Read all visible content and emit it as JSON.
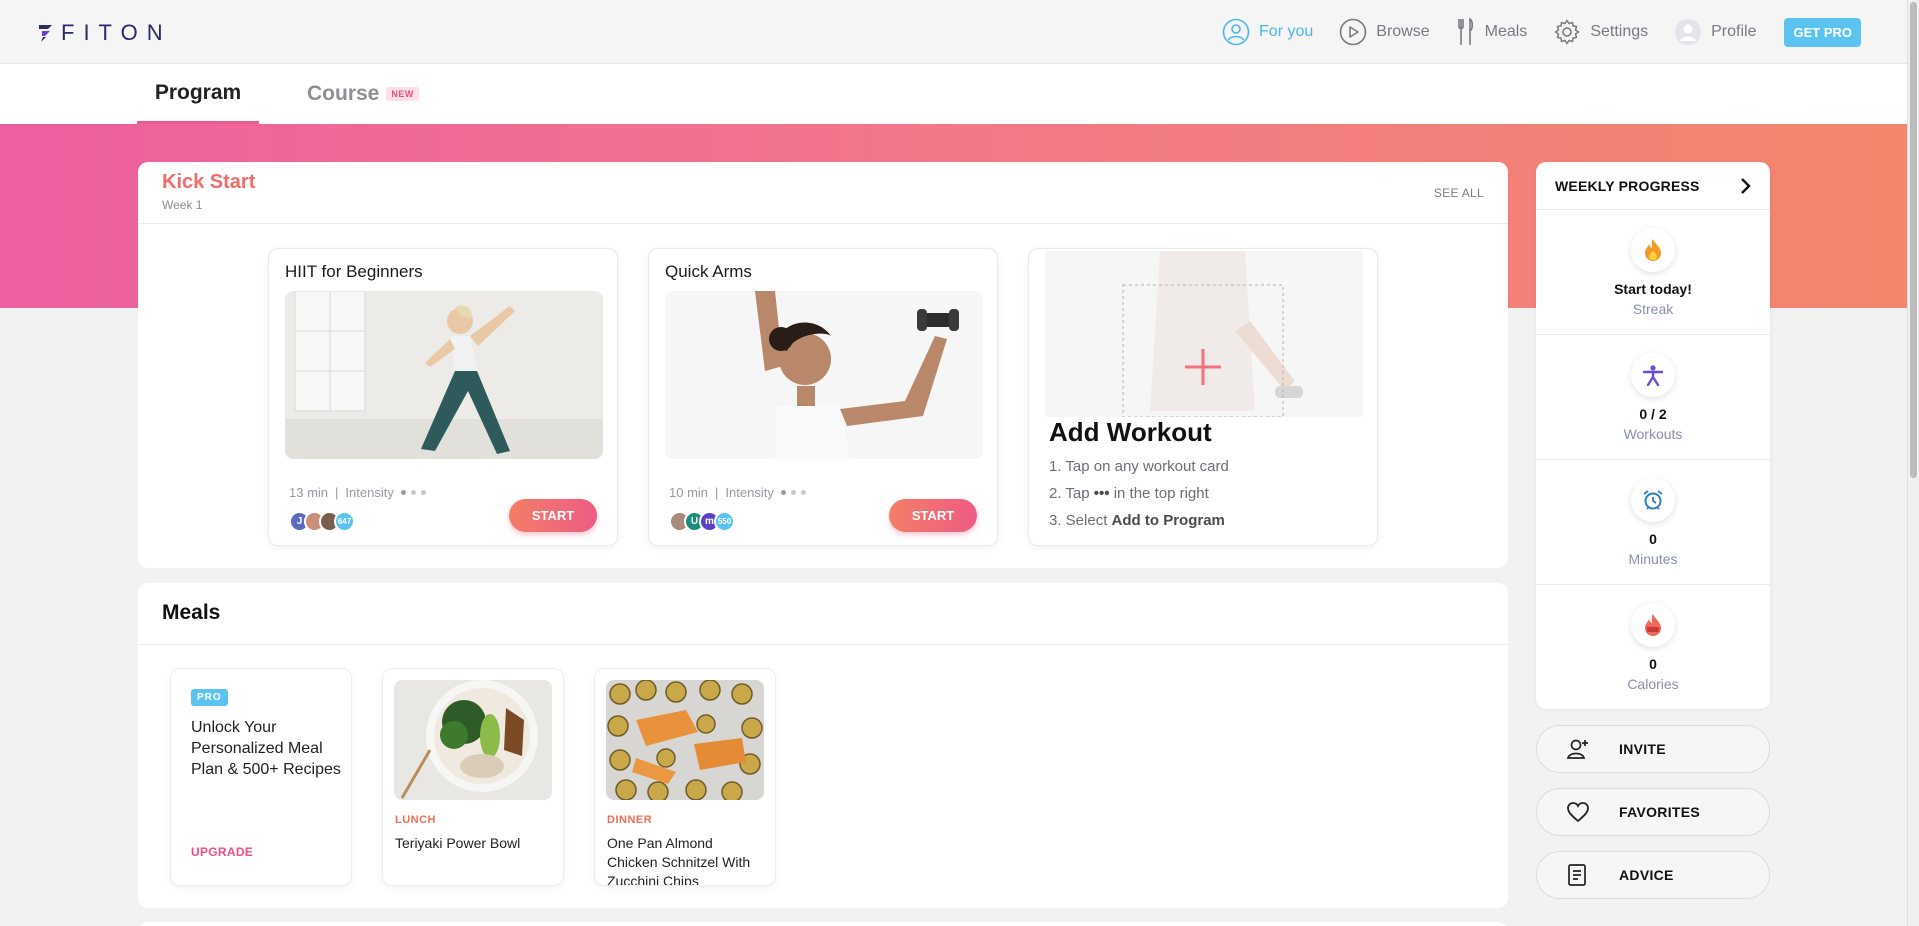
{
  "brand": {
    "name": "FITON"
  },
  "nav": {
    "items": [
      {
        "label": "For you",
        "icon": "user-circle-icon",
        "active": true
      },
      {
        "label": "Browse",
        "icon": "play-circle-icon",
        "active": false
      },
      {
        "label": "Meals",
        "icon": "fork-knife-icon",
        "active": false
      },
      {
        "label": "Settings",
        "icon": "gear-icon",
        "active": false
      },
      {
        "label": "Profile",
        "icon": "avatar-icon",
        "active": false
      }
    ],
    "cta": "GET PRO"
  },
  "tabs": {
    "program": "Program",
    "course": "Course",
    "course_badge": "NEW"
  },
  "kickstart": {
    "title": "Kick Start",
    "week": "Week 1",
    "see_all": "SEE ALL",
    "workouts": [
      {
        "title": "HIIT for Beginners",
        "duration": "13 min",
        "intensity_label": "Intensity",
        "intensity_level": 1,
        "participants_more": "647",
        "start": "START"
      },
      {
        "title": "Quick Arms",
        "duration": "10 min",
        "intensity_label": "Intensity",
        "intensity_level": 1,
        "participants_more": "550",
        "start": "START"
      }
    ],
    "add_workout": {
      "title": "Add Workout",
      "step1": "1. Tap on any workout card",
      "step2_pre": "2. Tap",
      "step2_dots": "•••",
      "step2_post": "in the top right",
      "step3_pre": "3. Select",
      "step3_bold": "Add to Program"
    }
  },
  "meals": {
    "title": "Meals",
    "pro_badge": "PRO",
    "unlock_text": "Unlock Your Personalized Meal Plan & 500+ Recipes",
    "upgrade": "UPGRADE",
    "items": [
      {
        "type": "LUNCH",
        "name": "Teriyaki Power Bowl"
      },
      {
        "type": "DINNER",
        "name": "One Pan Almond Chicken Schnitzel With Zucchini Chips"
      }
    ]
  },
  "weekly": {
    "title": "WEEKLY PROGRESS",
    "stats": [
      {
        "value": "Start today!",
        "label": "Streak",
        "icon": "flame-icon"
      },
      {
        "value": "0 / 2",
        "label": "Workouts",
        "icon": "workout-figure-icon"
      },
      {
        "value": "0",
        "label": "Minutes",
        "icon": "alarm-clock-icon"
      },
      {
        "value": "0",
        "label": "Calories",
        "icon": "calorie-flame-icon"
      }
    ]
  },
  "actions": {
    "invite": "INVITE",
    "favorites": "FAVORITES",
    "advice": "ADVICE"
  },
  "colors": {
    "accent_blue": "#4bb8ec",
    "accent_pink": "#ee5b8c",
    "accent_orange": "#f16b67"
  }
}
